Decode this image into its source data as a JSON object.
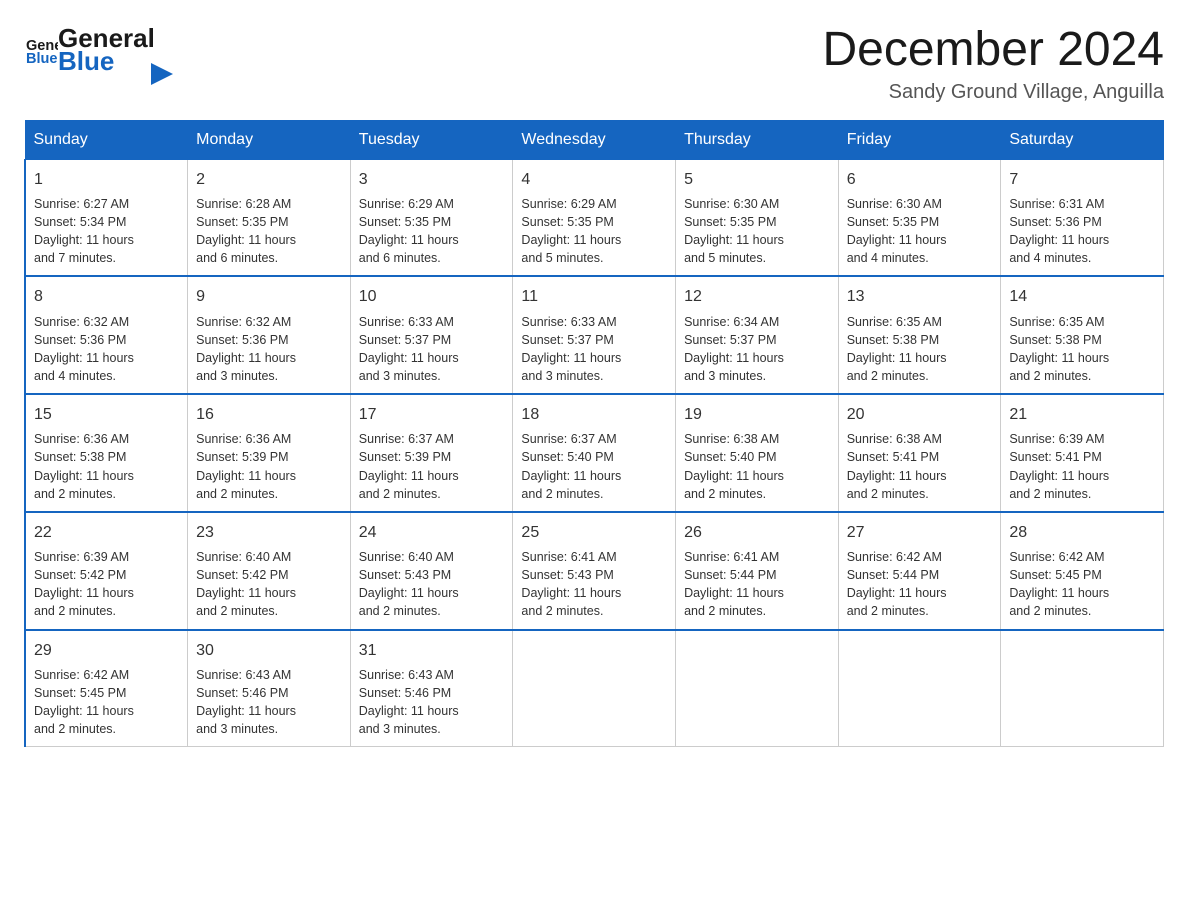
{
  "header": {
    "logo_general": "General",
    "logo_blue": "Blue",
    "month_title": "December 2024",
    "subtitle": "Sandy Ground Village, Anguilla"
  },
  "days_of_week": [
    "Sunday",
    "Monday",
    "Tuesday",
    "Wednesday",
    "Thursday",
    "Friday",
    "Saturday"
  ],
  "weeks": [
    [
      {
        "day": "1",
        "sunrise": "6:27 AM",
        "sunset": "5:34 PM",
        "daylight": "11 hours and 7 minutes."
      },
      {
        "day": "2",
        "sunrise": "6:28 AM",
        "sunset": "5:35 PM",
        "daylight": "11 hours and 6 minutes."
      },
      {
        "day": "3",
        "sunrise": "6:29 AM",
        "sunset": "5:35 PM",
        "daylight": "11 hours and 6 minutes."
      },
      {
        "day": "4",
        "sunrise": "6:29 AM",
        "sunset": "5:35 PM",
        "daylight": "11 hours and 5 minutes."
      },
      {
        "day": "5",
        "sunrise": "6:30 AM",
        "sunset": "5:35 PM",
        "daylight": "11 hours and 5 minutes."
      },
      {
        "day": "6",
        "sunrise": "6:30 AM",
        "sunset": "5:35 PM",
        "daylight": "11 hours and 4 minutes."
      },
      {
        "day": "7",
        "sunrise": "6:31 AM",
        "sunset": "5:36 PM",
        "daylight": "11 hours and 4 minutes."
      }
    ],
    [
      {
        "day": "8",
        "sunrise": "6:32 AM",
        "sunset": "5:36 PM",
        "daylight": "11 hours and 4 minutes."
      },
      {
        "day": "9",
        "sunrise": "6:32 AM",
        "sunset": "5:36 PM",
        "daylight": "11 hours and 3 minutes."
      },
      {
        "day": "10",
        "sunrise": "6:33 AM",
        "sunset": "5:37 PM",
        "daylight": "11 hours and 3 minutes."
      },
      {
        "day": "11",
        "sunrise": "6:33 AM",
        "sunset": "5:37 PM",
        "daylight": "11 hours and 3 minutes."
      },
      {
        "day": "12",
        "sunrise": "6:34 AM",
        "sunset": "5:37 PM",
        "daylight": "11 hours and 3 minutes."
      },
      {
        "day": "13",
        "sunrise": "6:35 AM",
        "sunset": "5:38 PM",
        "daylight": "11 hours and 2 minutes."
      },
      {
        "day": "14",
        "sunrise": "6:35 AM",
        "sunset": "5:38 PM",
        "daylight": "11 hours and 2 minutes."
      }
    ],
    [
      {
        "day": "15",
        "sunrise": "6:36 AM",
        "sunset": "5:38 PM",
        "daylight": "11 hours and 2 minutes."
      },
      {
        "day": "16",
        "sunrise": "6:36 AM",
        "sunset": "5:39 PM",
        "daylight": "11 hours and 2 minutes."
      },
      {
        "day": "17",
        "sunrise": "6:37 AM",
        "sunset": "5:39 PM",
        "daylight": "11 hours and 2 minutes."
      },
      {
        "day": "18",
        "sunrise": "6:37 AM",
        "sunset": "5:40 PM",
        "daylight": "11 hours and 2 minutes."
      },
      {
        "day": "19",
        "sunrise": "6:38 AM",
        "sunset": "5:40 PM",
        "daylight": "11 hours and 2 minutes."
      },
      {
        "day": "20",
        "sunrise": "6:38 AM",
        "sunset": "5:41 PM",
        "daylight": "11 hours and 2 minutes."
      },
      {
        "day": "21",
        "sunrise": "6:39 AM",
        "sunset": "5:41 PM",
        "daylight": "11 hours and 2 minutes."
      }
    ],
    [
      {
        "day": "22",
        "sunrise": "6:39 AM",
        "sunset": "5:42 PM",
        "daylight": "11 hours and 2 minutes."
      },
      {
        "day": "23",
        "sunrise": "6:40 AM",
        "sunset": "5:42 PM",
        "daylight": "11 hours and 2 minutes."
      },
      {
        "day": "24",
        "sunrise": "6:40 AM",
        "sunset": "5:43 PM",
        "daylight": "11 hours and 2 minutes."
      },
      {
        "day": "25",
        "sunrise": "6:41 AM",
        "sunset": "5:43 PM",
        "daylight": "11 hours and 2 minutes."
      },
      {
        "day": "26",
        "sunrise": "6:41 AM",
        "sunset": "5:44 PM",
        "daylight": "11 hours and 2 minutes."
      },
      {
        "day": "27",
        "sunrise": "6:42 AM",
        "sunset": "5:44 PM",
        "daylight": "11 hours and 2 minutes."
      },
      {
        "day": "28",
        "sunrise": "6:42 AM",
        "sunset": "5:45 PM",
        "daylight": "11 hours and 2 minutes."
      }
    ],
    [
      {
        "day": "29",
        "sunrise": "6:42 AM",
        "sunset": "5:45 PM",
        "daylight": "11 hours and 2 minutes."
      },
      {
        "day": "30",
        "sunrise": "6:43 AM",
        "sunset": "5:46 PM",
        "daylight": "11 hours and 3 minutes."
      },
      {
        "day": "31",
        "sunrise": "6:43 AM",
        "sunset": "5:46 PM",
        "daylight": "11 hours and 3 minutes."
      },
      null,
      null,
      null,
      null
    ]
  ],
  "labels": {
    "sunrise": "Sunrise:",
    "sunset": "Sunset:",
    "daylight": "Daylight:"
  },
  "accent_color": "#1565C0"
}
